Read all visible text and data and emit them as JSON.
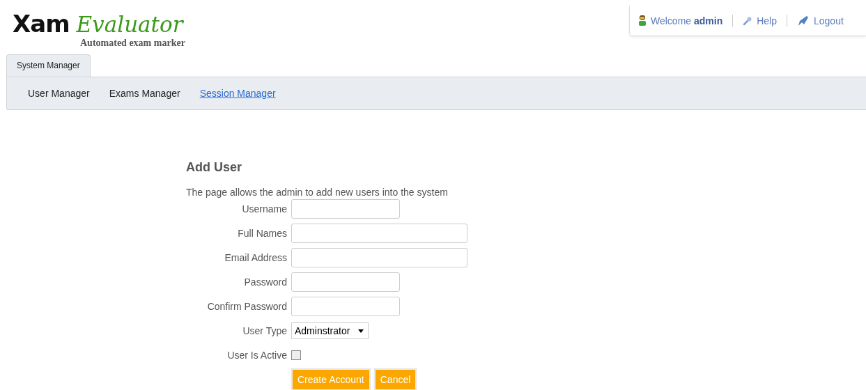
{
  "logo": {
    "mark": "Xam",
    "name": "Evaluator",
    "tagline": "Automated exam marker"
  },
  "user_menu": {
    "welcome": "Welcome **admin**",
    "help": "Help",
    "logout": "Logout"
  },
  "tabs": [
    {
      "label": "System Manager",
      "selected": true
    }
  ],
  "nav": [
    {
      "label": "User Manager",
      "selected": false
    },
    {
      "label": "Exams Manager",
      "selected": false
    },
    {
      "label": "Session Manager",
      "selected": true
    }
  ],
  "form": {
    "title": "Add User",
    "description": "The page allows the admin to add new users into the system",
    "fields": [
      {
        "label": "Username",
        "kind": "short"
      },
      {
        "label": "Full Names",
        "kind": "long"
      },
      {
        "label": "Email Address",
        "kind": "long"
      },
      {
        "label": "Password",
        "kind": "short"
      },
      {
        "label": "Confirm Password",
        "kind": "short"
      },
      {
        "label": "User Type",
        "kind": "select",
        "value": "Adminstrator"
      },
      {
        "label": "User Is Active",
        "kind": "checkbox",
        "checked": false
      }
    ],
    "buttons": [
      "Create Account",
      "Cancel"
    ]
  }
}
